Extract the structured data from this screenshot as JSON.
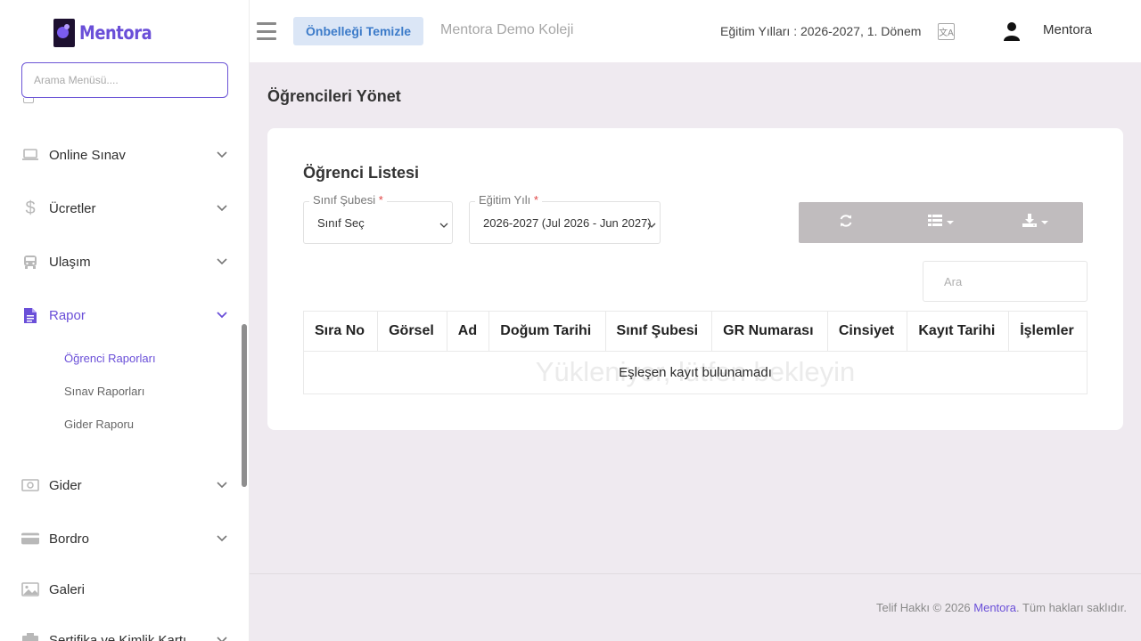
{
  "brand": {
    "name": "Mentora"
  },
  "sidebar": {
    "search_placeholder": "Arama Menüsü....",
    "items": [
      {
        "label": "Online Sınav",
        "icon": "laptop-icon"
      },
      {
        "label": "Ücretler",
        "icon": "dollar-icon"
      },
      {
        "label": "Ulaşım",
        "icon": "bus-icon"
      },
      {
        "label": "Rapor",
        "icon": "document-icon",
        "active": true
      },
      {
        "label": "Gider",
        "icon": "money-icon"
      },
      {
        "label": "Bordro",
        "icon": "credit-card-icon"
      },
      {
        "label": "Galeri",
        "icon": "image-icon"
      },
      {
        "label": "Sertifika ve Kimlik Kartı",
        "icon": "certificate-icon"
      }
    ],
    "subitems": [
      {
        "label": "Öğrenci Raporları",
        "active": true
      },
      {
        "label": "Sınav Raporları"
      },
      {
        "label": "Gider Raporu"
      }
    ]
  },
  "header": {
    "cache_button": "Önbelleği Temizle",
    "school_name": "Mentora Demo Koleji",
    "education_year": "Eğitim Yılları : 2026-2027, 1. Dönem",
    "lang_icon_text": "文A",
    "user_name": "Mentora"
  },
  "page": {
    "title": "Öğrencileri Yönet",
    "card_title": "Öğrenci Listesi"
  },
  "filters": {
    "class_label": "Sınıf Şubesi",
    "class_value": "Sınıf Seç",
    "year_label": "Eğitim Yılı",
    "year_value": "2026-2027 (Jul 2026 - Jun 2027)",
    "required_mark": "*"
  },
  "table": {
    "search_placeholder": "Ara",
    "columns": [
      "Sıra No",
      "Görsel",
      "Ad",
      "Doğum Tarihi",
      "Sınıf Şubesi",
      "GR Numarası",
      "Cinsiyet",
      "Kayıt Tarihi",
      "İşlemler"
    ],
    "loading_text": "Yükleniyor, lütfen bekleyin",
    "empty_text": "Eşleşen kayıt bulunamadı"
  },
  "footer": {
    "prefix": "Telif Hakkı © 2026 ",
    "brand": "Mentora",
    "suffix": ". Tüm hakları saklıdır."
  },
  "colors": {
    "accent": "#6a4fd8",
    "cache_button_bg": "#dbe6f6",
    "cache_button_text": "#3c7bc9",
    "toolbar_bg": "#c0bcbe",
    "page_bg": "#efeaf0"
  }
}
